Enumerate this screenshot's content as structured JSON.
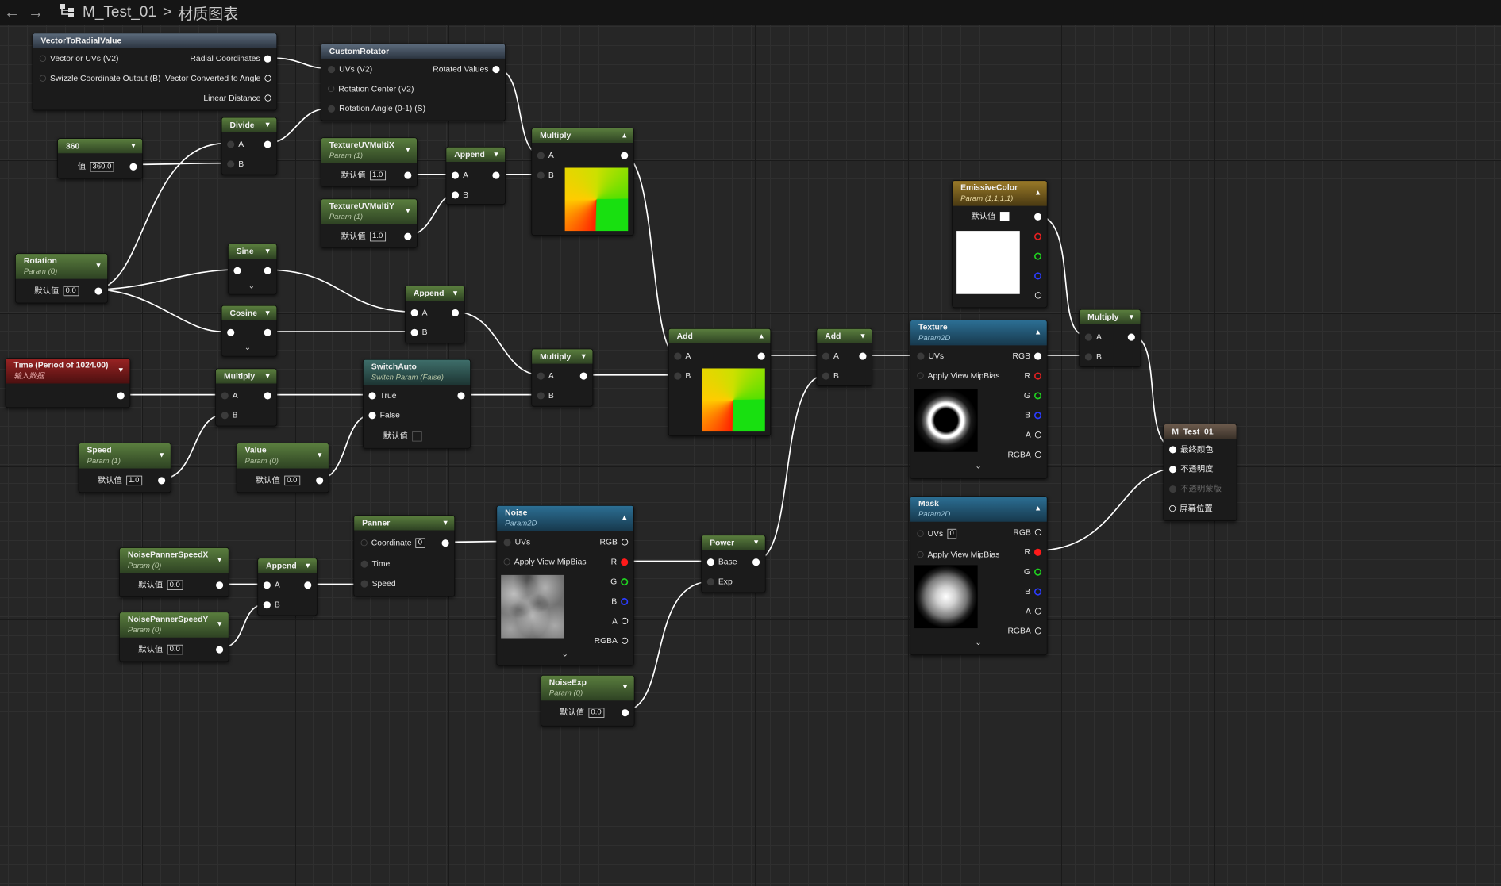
{
  "topbar": {
    "back_icon": "←",
    "forward_icon": "→",
    "asset_name": "M_Test_01",
    "separator": ">",
    "graph_name": "材质图表"
  },
  "nodes": {
    "vec_radial": {
      "title": "VectorToRadialValue",
      "in1": "Vector or UVs (V2)",
      "in2": "Swizzle Coordinate Output (B)",
      "out1": "Radial Coordinates",
      "out2": "Vector Converted to Angle",
      "out3": "Linear Distance"
    },
    "custom_rotator": {
      "title": "CustomRotator",
      "in1": "UVs (V2)",
      "in2": "Rotation Center (V2)",
      "in3": "Rotation Angle (0-1) (S)",
      "out1": "Rotated Values"
    },
    "const360": {
      "title": "360",
      "label": "值",
      "value": "360.0"
    },
    "divide": {
      "title": "Divide",
      "a": "A",
      "b": "B"
    },
    "tex_uv_x": {
      "title": "TextureUVMultiX",
      "sub": "Param (1)",
      "label": "默认值",
      "value": "1.0"
    },
    "tex_uv_y": {
      "title": "TextureUVMultiY",
      "sub": "Param (1)",
      "label": "默认值",
      "value": "1.0"
    },
    "append1": {
      "title": "Append",
      "a": "A",
      "b": "B"
    },
    "multiply1": {
      "title": "Multiply",
      "a": "A",
      "b": "B"
    },
    "rotation": {
      "title": "Rotation",
      "sub": "Param (0)",
      "label": "默认值",
      "value": "0.0"
    },
    "sine": {
      "title": "Sine"
    },
    "cosine": {
      "title": "Cosine"
    },
    "append2": {
      "title": "Append",
      "a": "A",
      "b": "B"
    },
    "time": {
      "title": "Time (Period of 1024.00)",
      "sub": "输入数据"
    },
    "multiply2": {
      "title": "Multiply",
      "a": "A",
      "b": "B"
    },
    "switch_auto": {
      "title": "SwitchAuto",
      "sub": "Switch Param (False)",
      "in1": "True",
      "in2": "False",
      "label": "默认值"
    },
    "multiply3": {
      "title": "Multiply",
      "a": "A",
      "b": "B"
    },
    "speed": {
      "title": "Speed",
      "sub": "Param (1)",
      "label": "默认值",
      "value": "1.0"
    },
    "value": {
      "title": "Value",
      "sub": "Param (0)",
      "label": "默认值",
      "value": "0.0"
    },
    "add1": {
      "title": "Add",
      "a": "A",
      "b": "B"
    },
    "add2": {
      "title": "Add",
      "a": "A",
      "b": "B"
    },
    "emissive": {
      "title": "EmissiveColor",
      "sub": "Param (1,1,1,1)",
      "label": "默认值"
    },
    "texture": {
      "title": "Texture",
      "sub": "Param2D",
      "in1": "UVs",
      "in2": "Apply View MipBias",
      "out_rgb": "RGB",
      "out_r": "R",
      "out_g": "G",
      "out_b": "B",
      "out_a": "A",
      "out_rgba": "RGBA"
    },
    "multiply4": {
      "title": "Multiply",
      "a": "A",
      "b": "B"
    },
    "result": {
      "title": "M_Test_01",
      "p1": "最终颜色",
      "p2": "不透明度",
      "p3": "不透明蒙版",
      "p4": "屏幕位置"
    },
    "mask": {
      "title": "Mask",
      "sub": "Param2D",
      "in1": "UVs",
      "uv_value": "0",
      "in2": "Apply View MipBias",
      "out_rgb": "RGB",
      "out_r": "R",
      "out_g": "G",
      "out_b": "B",
      "out_a": "A",
      "out_rgba": "RGBA"
    },
    "panner": {
      "title": "Panner",
      "in1": "Coordinate",
      "coord_value": "0",
      "in2": "Time",
      "in3": "Speed"
    },
    "noise": {
      "title": "Noise",
      "sub": "Param2D",
      "in1": "UVs",
      "in2": "Apply View MipBias",
      "out_rgb": "RGB",
      "out_r": "R",
      "out_g": "G",
      "out_b": "B",
      "out_a": "A",
      "out_rgba": "RGBA"
    },
    "power": {
      "title": "Power",
      "in1": "Base",
      "in2": "Exp"
    },
    "noise_speed_x": {
      "title": "NoisePannerSpeedX",
      "sub": "Param (0)",
      "label": "默认值",
      "value": "0.0"
    },
    "noise_speed_y": {
      "title": "NoisePannerSpeedY",
      "sub": "Param (0)",
      "label": "默认值",
      "value": "0.0"
    },
    "append3": {
      "title": "Append",
      "a": "A",
      "b": "B"
    },
    "noise_exp": {
      "title": "NoiseExp",
      "sub": "Param (0)",
      "label": "默认值",
      "value": "0.0"
    }
  },
  "colors": {
    "wire": "#ffffff",
    "header_param": "#4f6f38",
    "header_texture": "#256685",
    "header_time": "#8a1f1f",
    "header_vector_param": "#8a6d22",
    "canvas": "#262626"
  }
}
